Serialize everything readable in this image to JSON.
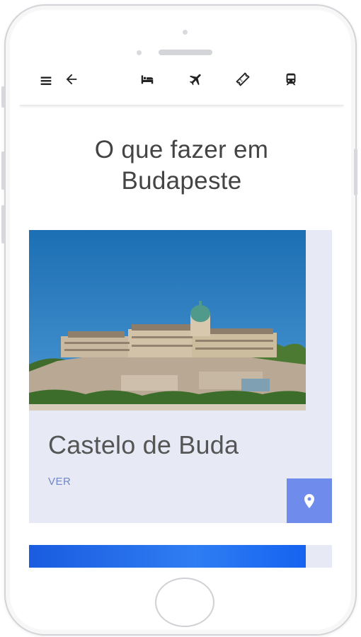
{
  "header": {
    "title": "O que fazer em Budapeste",
    "icons": [
      "menu-icon",
      "back-arrow-icon",
      "hotel-bed-icon",
      "flight-icon",
      "ticket-icon",
      "train-icon"
    ]
  },
  "cards": [
    {
      "title": "Castelo de Buda",
      "link_label": "VER",
      "image": "budapest-castle-photo",
      "action_icon": "map-pin-icon"
    },
    {
      "image": "blue-photo"
    }
  ],
  "colors": {
    "card_bg": "#e7eaf4",
    "accent": "#6f8cec",
    "link": "#6f86c8"
  }
}
